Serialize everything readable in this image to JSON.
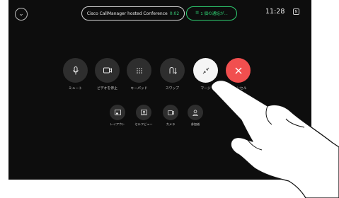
{
  "top_bar": {
    "conference_label": "Cisco CallManager hosted Conference",
    "conference_timer": "0:02",
    "held_calls_label": "1 個の通話が...",
    "clock": "11:28",
    "badge": "N"
  },
  "controls": {
    "mute": "ミュート",
    "stop_video": "ビデオを停止",
    "keypad": "キーパッド",
    "swap": "スワップ",
    "merge": "マージ",
    "cancel": "キャンセル",
    "layout": "レイアウト",
    "self_view": "セルフビュー",
    "camera": "カメラ",
    "participants": "参加者"
  },
  "icons": {
    "back": "chevron-down-icon",
    "mute": "microphone-icon",
    "stop_video": "camera-icon",
    "keypad": "keypad-icon",
    "swap": "swap-icon",
    "merge": "merge-icon",
    "cancel": "close-icon",
    "layout": "layout-icon",
    "self_view": "self-view-icon",
    "camera": "camera-control-icon",
    "participants": "person-icon"
  },
  "colors": {
    "background": "#0d0d0d",
    "accent_green": "#2ecf72",
    "cancel_red": "#f14f4f",
    "button_gray": "#2e2e2e"
  }
}
